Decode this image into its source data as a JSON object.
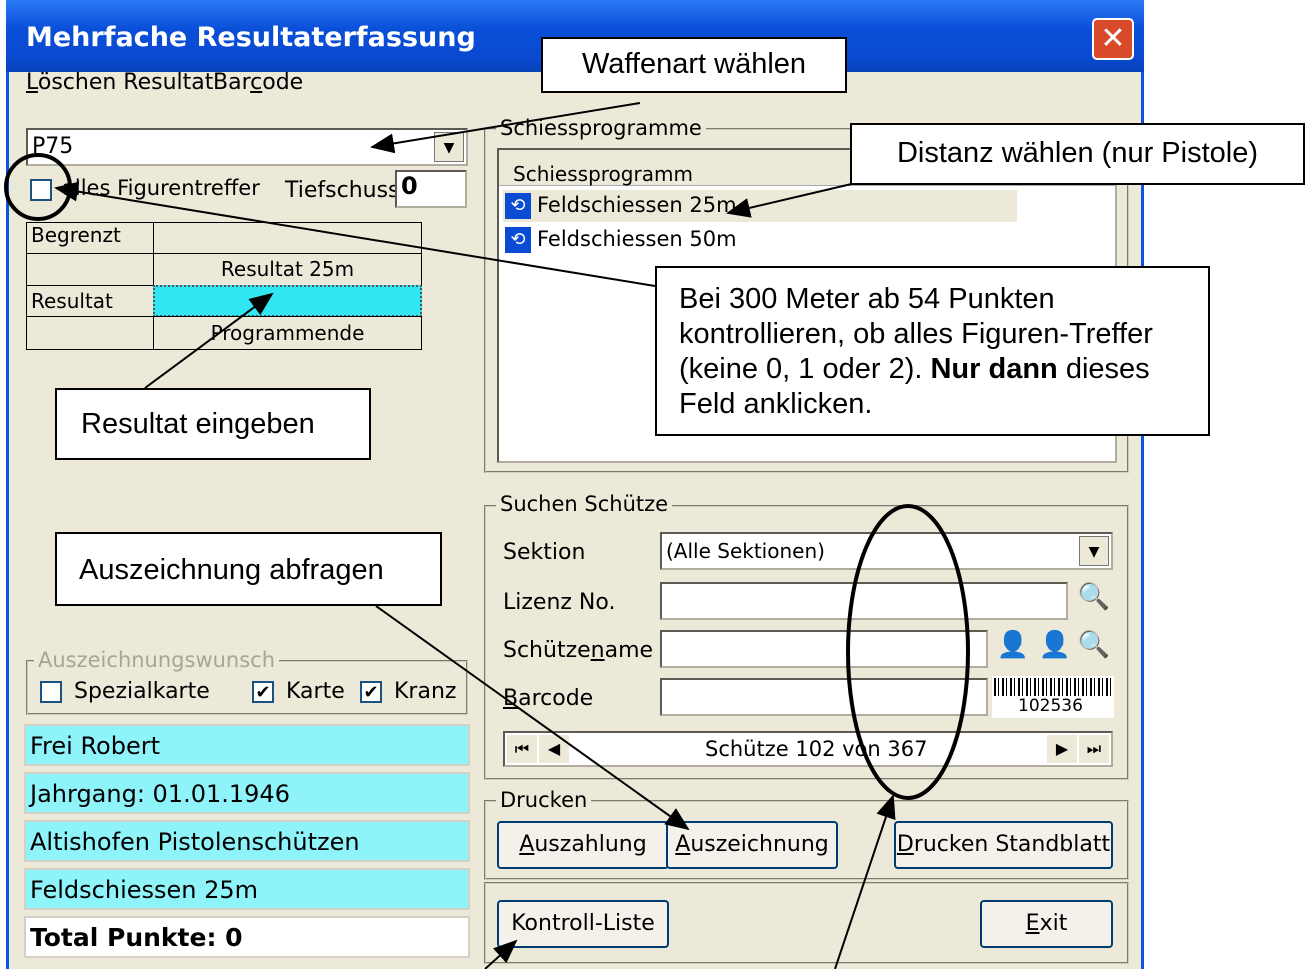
{
  "window": {
    "title": "Mehrfache Resultaterfassung",
    "close": "✕"
  },
  "menu": {
    "item1": "Löschen Resultat",
    "item2": "Barcode"
  },
  "left": {
    "weapon_value": "P75",
    "all_figure_label": "alles Figurentreffer",
    "tiefschuss_label": "Tiefschuss",
    "tiefschuss_value": "0",
    "grid": {
      "begrenzt": "Begrenzt",
      "resultat_25m": "Resultat 25m",
      "resultat": "Resultat",
      "programmende": "Programmende"
    },
    "awards": {
      "title": "Auszeichnungswunsch",
      "spezialkarte": "Spezialkarte",
      "karte": "Karte",
      "kranz": "Kranz",
      "karte_checked": "✔",
      "kranz_checked": "✔"
    },
    "info": {
      "name": "Frei Robert",
      "jahrgang": "Jahrgang: 01.01.1946",
      "verein": "Altishofen Pistolenschützen",
      "programm": "Feldschiessen 25m",
      "total": "Total Punkte: 0"
    }
  },
  "programs": {
    "title": "Schiessprogramme",
    "column": "Schiessprogramm",
    "items": [
      "Feldschiessen 25m",
      "Feldschiessen 50m"
    ]
  },
  "search": {
    "title": "Suchen Schütze",
    "sektion_label": "Sektion",
    "sektion_value": "(Alle Sektionen)",
    "lizenz_label": "Lizenz No.",
    "name_label": "Schützename",
    "barcode_label": "Barcode",
    "barcode_number": "102536",
    "nav_text": "Schütze 102 von 367"
  },
  "print": {
    "title": "Drucken",
    "auszahlung": "Auszahlung",
    "auszeichnung": "Auszeichnung",
    "standblatt": "Drucken Standblatt"
  },
  "bottom": {
    "kontroll": "Kontroll-Liste",
    "exit": "Exit"
  },
  "callouts": {
    "waffenart": "Waffenart wählen",
    "distanz": "Distanz wählen (nur Pistole)",
    "resultat": "Resultat eingeben",
    "auszeichnung": "Auszeichnung abfragen",
    "hint_1": "Bei 300 Meter ab 54 Punkten kontrollieren, ob alles Figuren-Treffer (keine 0, 1 oder 2). ",
    "hint_bold": "Nur dann",
    "hint_2": " dieses Feld anklicken."
  },
  "colors": {
    "titlebar": "#0a4fd8",
    "field_cyan": "#8ff3fa",
    "window_bg": "#ece9d8"
  }
}
